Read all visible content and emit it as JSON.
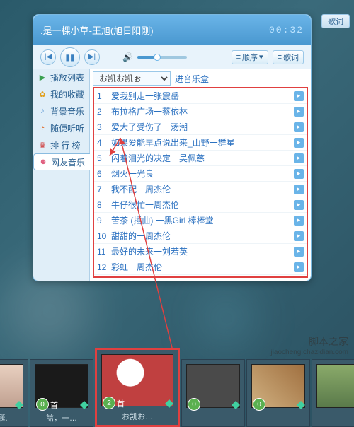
{
  "player": {
    "now_playing": ".是一棵小草-王旭(旭日阳刚)",
    "time": "00:32",
    "mode_label": "顺序",
    "lyric_label": "歌词",
    "ext_lyric_label": "歌词"
  },
  "sidebar": {
    "items": [
      {
        "label": "播放列表"
      },
      {
        "label": "我的收藏"
      },
      {
        "label": "背景音乐"
      },
      {
        "label": "随便听听"
      },
      {
        "label": "排 行 榜"
      },
      {
        "label": "网友音乐"
      }
    ]
  },
  "main": {
    "selector_value": "お凯お凯ぉ",
    "music_box_link": "进音乐盒"
  },
  "tracks": [
    {
      "num": "1",
      "name": "爱我别走一张震岳"
    },
    {
      "num": "2",
      "name": "布拉格广场一蔡依林"
    },
    {
      "num": "3",
      "name": "爱大了受伤了一汤潮"
    },
    {
      "num": "4",
      "name": "如果爱能早点说出来_山野一群星"
    },
    {
      "num": "5",
      "name": "闪着泪光的决定一吴佩慈"
    },
    {
      "num": "6",
      "name": "烟火一光良"
    },
    {
      "num": "7",
      "name": "我不配一周杰伦"
    },
    {
      "num": "8",
      "name": "牛仔很忙一周杰伦"
    },
    {
      "num": "9",
      "name": "苦茶 (插曲) 一黑Girl 棒棒堂"
    },
    {
      "num": "10",
      "name": "甜甜的一周杰伦"
    },
    {
      "num": "11",
      "name": "最好的未来一刘若英"
    },
    {
      "num": "12",
      "name": "彩虹一周杰伦"
    }
  ],
  "dock": [
    {
      "label": ". 燻娫."
    },
    {
      "label": "誩，一…"
    },
    {
      "label": "お凯お…",
      "badge": "2",
      "badge_txt": "首"
    },
    {
      "label": ""
    },
    {
      "label": ""
    },
    {
      "label": ""
    }
  ],
  "watermark": {
    "title": "脚本之家",
    "url": "jiaocheng.chazidian.com"
  }
}
